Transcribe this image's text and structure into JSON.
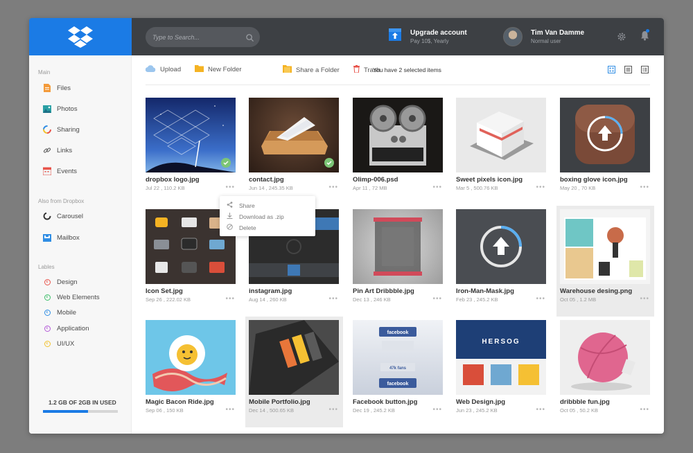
{
  "header": {
    "search_placeholder": "Type to Search...",
    "upgrade_title": "Upgrade account",
    "upgrade_sub": "Pay 10$, Yearly",
    "user_name": "Tim Van Damme",
    "user_role": "Normal user"
  },
  "sidebar": {
    "main_title": "Main",
    "main_items": [
      {
        "label": "Files",
        "icon": "files-icon"
      },
      {
        "label": "Photos",
        "icon": "photos-icon"
      },
      {
        "label": "Sharing",
        "icon": "sharing-icon"
      },
      {
        "label": "Links",
        "icon": "links-icon"
      },
      {
        "label": "Events",
        "icon": "events-icon"
      }
    ],
    "also_title": "Also from Dropbox",
    "also_items": [
      {
        "label": "Carousel",
        "icon": "carousel-icon"
      },
      {
        "label": "Mailbox",
        "icon": "mailbox-icon"
      }
    ],
    "labels_title": "Lables",
    "labels": [
      {
        "label": "Design",
        "color": "#e8534a"
      },
      {
        "label": "Web Elements",
        "color": "#3dbf6a"
      },
      {
        "label": "Mobile",
        "color": "#2f8de4"
      },
      {
        "label": "Application",
        "color": "#b45ad8"
      },
      {
        "label": "UI/UX",
        "color": "#f2c12e"
      }
    ],
    "storage_text": "1.2 GB OF 2GB IN USED",
    "storage_fraction": 0.6
  },
  "toolbar": {
    "upload": "Upload",
    "new_folder": "New Folder",
    "share_folder": "Share a Folder",
    "trash": "Trash",
    "selected_text": "You have 2 selected items"
  },
  "files": [
    {
      "name": "dropbox logo.jpg",
      "meta": "Jul 22 , 110.2 KB",
      "checked": true
    },
    {
      "name": "contact.jpg",
      "meta": "Jun 14 , 245.35 KB",
      "checked": true
    },
    {
      "name": "Olimp-006.psd",
      "meta": "Apr 11 , 72 MB"
    },
    {
      "name": "Sweet pixels icon.jpg",
      "meta": "Mar 5 , 500.76 KB"
    },
    {
      "name": "boxing glove icon.jpg",
      "meta": "May 20 , 70 KB"
    },
    {
      "name": "Icon Set.jpg",
      "meta": "Sep 26 , 222.02 KB"
    },
    {
      "name": "instagram.jpg",
      "meta": "Aug 14 , 260 KB"
    },
    {
      "name": "Pin Art Dribbble.jpg",
      "meta": "Dec 13 , 246 KB"
    },
    {
      "name": "Iron-Man-Mask.jpg",
      "meta": "Feb 23 , 245.2 KB"
    },
    {
      "name": "Warehouse desing.png",
      "meta": "Oct 05 , 1.2 MB"
    },
    {
      "name": "Magic Bacon Ride.jpg",
      "meta": "Sep 06 , 150 KB"
    },
    {
      "name": "Mobile Portfolio.jpg",
      "meta": "Dec 14 , 500.65 KB"
    },
    {
      "name": "Facebook button.jpg",
      "meta": "Dec 19 , 245.2 KB"
    },
    {
      "name": "Web Design.jpg",
      "meta": "Jun 23 , 245.2 KB"
    },
    {
      "name": "dribbble fun.jpg",
      "meta": "Oct 05 , 50.2 KB"
    }
  ],
  "thumb_texts": {
    "facebook": "facebook",
    "fans": "47k fans",
    "hersog": "HERSOG"
  },
  "context_menu": {
    "share": "Share",
    "download": "Download as .zip",
    "delete": "Delete"
  }
}
